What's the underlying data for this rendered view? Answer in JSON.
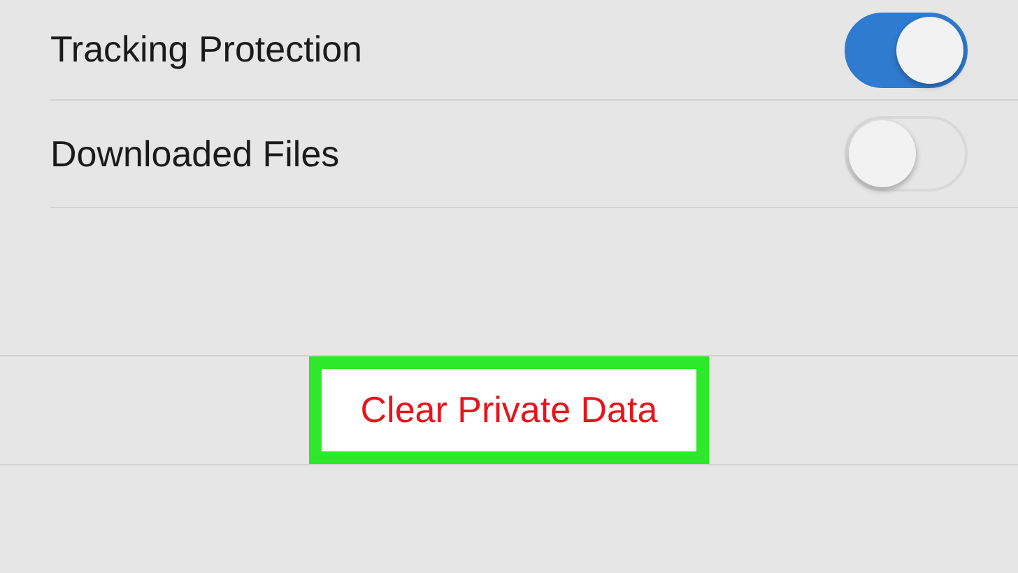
{
  "settings": [
    {
      "label": "Tracking Protection",
      "on": true
    },
    {
      "label": "Downloaded Files",
      "on": false
    }
  ],
  "action": {
    "label": "Clear Private Data",
    "highlighted": true
  }
}
